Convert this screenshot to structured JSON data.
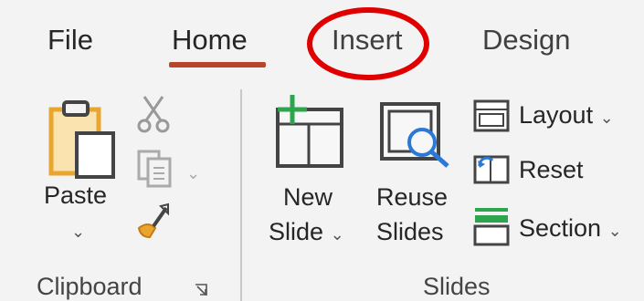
{
  "tabs": [
    {
      "label": "File"
    },
    {
      "label": "Home"
    },
    {
      "label": "Insert"
    },
    {
      "label": "Design"
    }
  ],
  "clipboard": {
    "group_label": "Clipboard",
    "paste_label": "Paste",
    "paste_chevron": "⌄",
    "copy_chevron": "⌄",
    "dialog_launcher_icon": "dialog-launcher-icon"
  },
  "slides": {
    "group_label": "Slides",
    "new_slide_line1": "New",
    "new_slide_line2": "Slide",
    "new_slide_chevron": "⌄",
    "reuse_slides_line1": "Reuse",
    "reuse_slides_line2": "Slides",
    "layout_label": "Layout",
    "layout_chevron": "⌄",
    "reset_label": "Reset",
    "section_label": "Section",
    "section_chevron": "⌄"
  },
  "colors": {
    "ribbon_bg": "#f3f3f3",
    "home_underline": "#b7472a",
    "annotation_circle": "#e00000",
    "icon_gray": "#444444",
    "icon_accent_green": "#2da44e",
    "icon_accent_blue": "#2b79d6",
    "paste_orange": "#e8a530"
  },
  "annotation": {
    "shape": "red-ellipse",
    "target": "tab-insert"
  }
}
